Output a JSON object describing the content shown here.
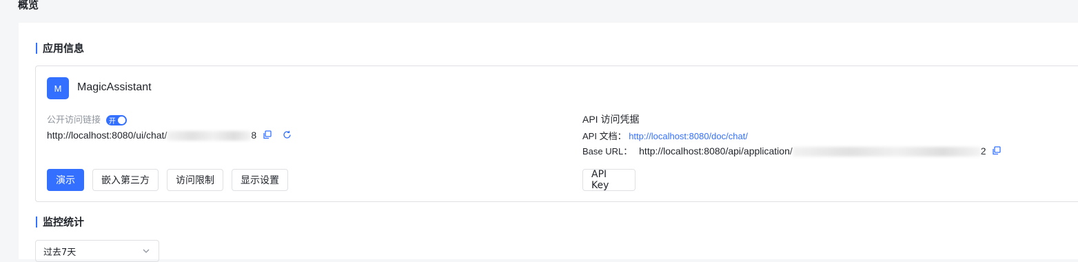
{
  "page_title": "概览",
  "app_info": {
    "section_title": "应用信息",
    "avatar_letter": "M",
    "app_name": "MagicAssistant",
    "public_link_label": "公开访问链接",
    "toggle_label": "开",
    "public_link_prefix": "http://localhost:8080/ui/chat/",
    "public_link_suffix": "8",
    "buttons": {
      "demo": "演示",
      "embed": "嵌入第三方",
      "access_limit": "访问限制",
      "display_settings": "显示设置",
      "api_key": "API Key"
    },
    "api_credentials_label": "API 访问凭据",
    "api_doc_label": "API 文档：",
    "api_doc_url": "http://localhost:8080/doc/chat/",
    "base_url_label": "Base URL：",
    "base_url_prefix": "http://localhost:8080/api/application/",
    "base_url_suffix": "2"
  },
  "monitor": {
    "section_title": "监控统计",
    "range_selected": "过去7天"
  },
  "colors": {
    "accent": "#3370ff",
    "border": "#dee0e3",
    "muted": "#8f959e"
  },
  "icons": [
    "copy-icon",
    "refresh-icon",
    "chevron-down-icon"
  ]
}
